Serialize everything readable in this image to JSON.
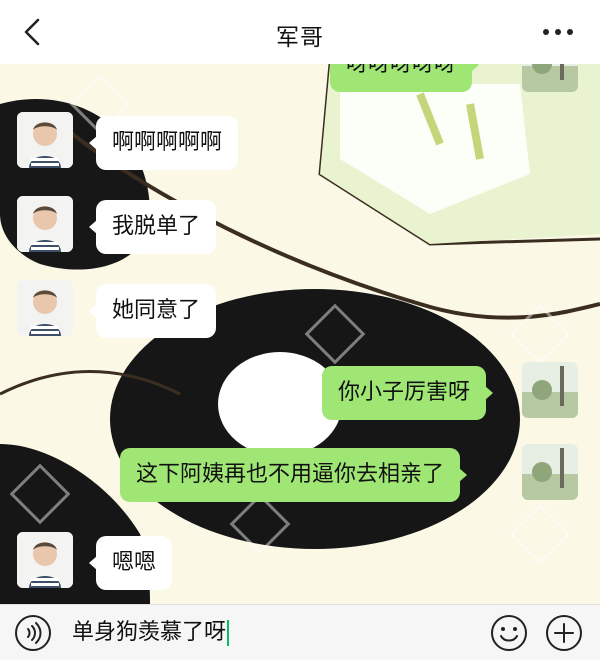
{
  "header": {
    "back_icon": "chevron-left-icon",
    "title": "军哥",
    "more_icon": "more-dots-icon"
  },
  "messages": [
    {
      "side": "out",
      "text": "呀呀呀呀呀",
      "avatar": "my-avatar-landscape"
    },
    {
      "side": "in",
      "text": "啊啊啊啊啊",
      "avatar": "contact-avatar-child"
    },
    {
      "side": "in",
      "text": "我脱单了",
      "avatar": "contact-avatar-child"
    },
    {
      "side": "in",
      "text": "她同意了",
      "avatar": "contact-avatar-child"
    },
    {
      "side": "out",
      "text": "你小子厉害呀",
      "avatar": "my-avatar-landscape"
    },
    {
      "side": "out",
      "text": "这下阿姨再也不用逼你去相亲了",
      "avatar": "my-avatar-landscape"
    },
    {
      "side": "in",
      "text": "嗯嗯",
      "avatar": "contact-avatar-child"
    }
  ],
  "input": {
    "voice_icon": "voice-icon",
    "value": "单身狗羡慕了呀",
    "emoji_icon": "emoji-icon",
    "plus_icon": "plus-icon"
  },
  "colors": {
    "incoming_bubble": "#ffffff",
    "outgoing_bubble": "#a0e675",
    "chat_background": "#fbf8e6",
    "cursor": "#07c160"
  }
}
